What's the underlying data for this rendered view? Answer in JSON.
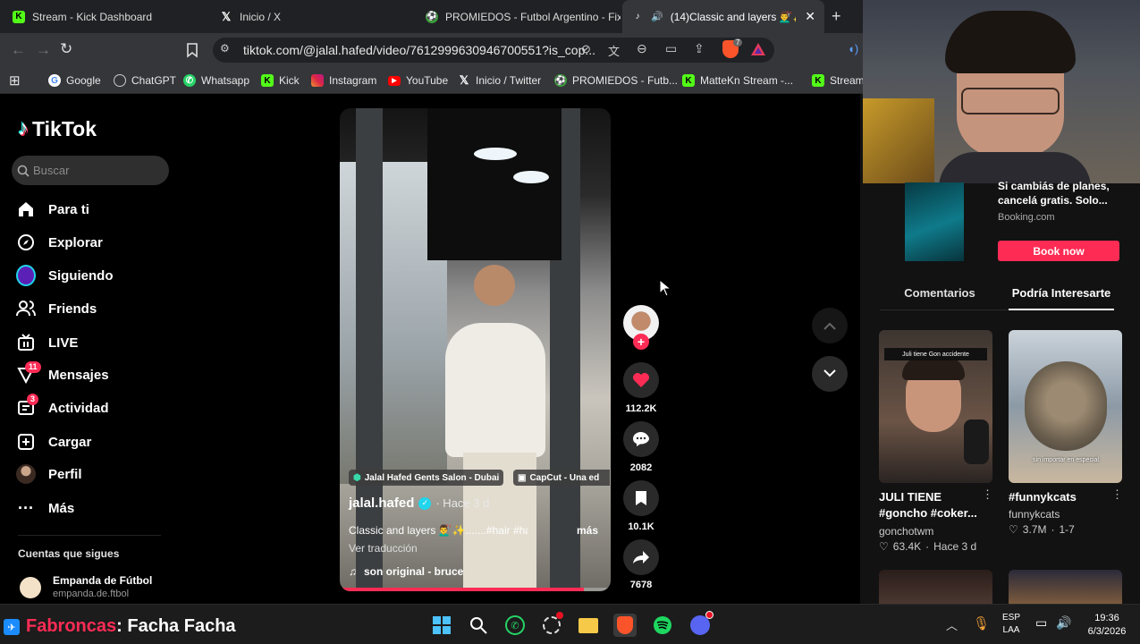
{
  "browser": {
    "tabs": [
      {
        "title": "Stream - Kick Dashboard",
        "favicon": "kick-icon"
      },
      {
        "title": "Inicio / X",
        "favicon": "x-icon"
      },
      {
        "title": "PROMIEDOS - Futbol Argentino - Fixt",
        "favicon": "promiedos-icon"
      },
      {
        "title": "(14)Classic and layers 💇‍♂️✨ .",
        "favicon": "tiktok-icon"
      }
    ],
    "url": "tiktok.com/@jalal.hafed/video/7612999630946700551?is_cop...",
    "bookmarks": [
      "Google",
      "ChatGPT",
      "Whatsapp",
      "Kick",
      "Instagram",
      "YouTube",
      "Inicio / Twitter",
      "PROMIEDOS - Futb...",
      "MatteKn Stream -...",
      "Stream"
    ],
    "brave_badge": "7"
  },
  "sidebar": {
    "logo": "TikTok",
    "search_placeholder": "Buscar",
    "nav": [
      {
        "label": "Para ti",
        "icon": "home-icon"
      },
      {
        "label": "Explorar",
        "icon": "compass-icon"
      },
      {
        "label": "Siguiendo",
        "icon": "following-icon"
      },
      {
        "label": "Friends",
        "icon": "friends-icon"
      },
      {
        "label": "LIVE",
        "icon": "live-icon"
      },
      {
        "label": "Mensajes",
        "icon": "messages-icon",
        "badge": "11"
      },
      {
        "label": "Actividad",
        "icon": "activity-icon",
        "badge": "3"
      },
      {
        "label": "Cargar",
        "icon": "upload-icon"
      },
      {
        "label": "Perfil",
        "icon": "profile-icon"
      },
      {
        "label": "Más",
        "icon": "more-icon"
      }
    ],
    "following_heading": "Cuentas que sigues",
    "following": [
      {
        "name": "Empanda de Fútbol",
        "handle": "empanda.de.ftbol"
      }
    ]
  },
  "video": {
    "tag1": "Jalal Hafed Gents Salon - Dubai",
    "tag2": "CapCut - Una ed",
    "author": "jalal.hafed",
    "time": "· Hace 3 d",
    "caption": "Classic and layers 💇‍♂️✨.......#hair #haircut...",
    "more": "más",
    "translate": "Ver traducción",
    "sound": "son original - bruce",
    "progress": 0.9
  },
  "actions": {
    "likes": "112.2K",
    "comments": "2082",
    "saves": "10.1K",
    "shares": "7678"
  },
  "ad": {
    "text": "Si cambiás de planes, cancelá gratis. Solo...",
    "source": "Booking.com",
    "cta": "Book now"
  },
  "right_tabs": [
    "Comentarios",
    "Podría Interesarte"
  ],
  "suggestions": [
    {
      "title": "JULI TIENE #goncho #coker...",
      "author": "gonchotwm",
      "likes": "63.4K",
      "time": "Hace 3 d",
      "thumb_caption": "Juli tiene Gon accidente"
    },
    {
      "title": "#funnykcats",
      "author": "funnykcats",
      "likes": "3.7M",
      "time": "1-7",
      "thumb_caption": "sin importar en especial"
    }
  ],
  "overlay": {
    "user": "Fabroncas",
    "message": ": Facha Facha"
  },
  "taskbar": {
    "lang": "ESP",
    "layout": "LAA",
    "time": "19:36",
    "date": "6/3/2026"
  },
  "colors": {
    "accent": "#fe2c55",
    "teal": "#20d5ec"
  }
}
